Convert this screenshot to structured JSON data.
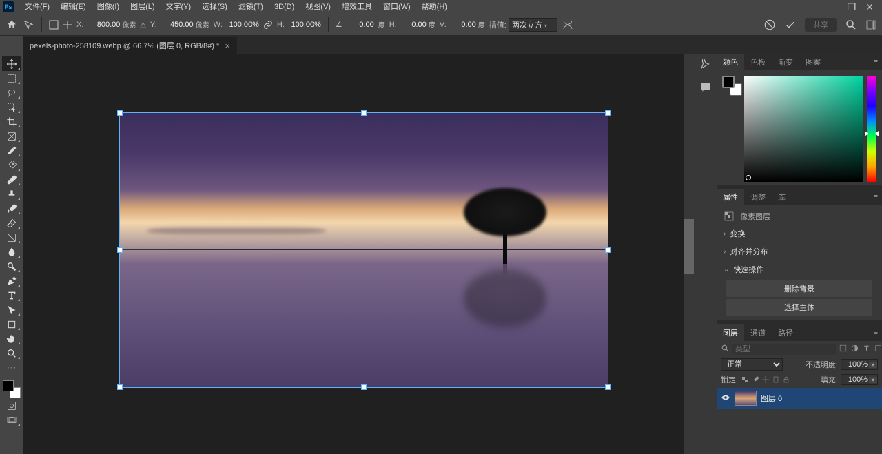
{
  "menu": {
    "file": "文件(F)",
    "edit": "编辑(E)",
    "image": "图像(I)",
    "layer": "图层(L)",
    "type": "文字(Y)",
    "select": "选择(S)",
    "filter": "滤镜(T)",
    "threed": "3D(D)",
    "view": "视图(V)",
    "plugins": "增效工具",
    "window": "窗口(W)",
    "help": "帮助(H)"
  },
  "optbar": {
    "x_lbl": "X:",
    "x": "800.00",
    "x_unit": "像素",
    "y_lbl": "Y:",
    "y": "450.00",
    "y_unit": "像素",
    "w_lbl": "W:",
    "w": "100.00%",
    "h_lbl": "H:",
    "h": "100.00%",
    "angle_icon": "△",
    "angle": "0.00",
    "angle_unit": "度",
    "hskew_lbl": "H:",
    "hskew": "0.00",
    "hskew_unit": "度",
    "vskew_lbl": "V:",
    "vskew": "0.00",
    "vskew_unit": "度",
    "interp_lbl": "插值:",
    "interp": "两次立方",
    "share": "共享"
  },
  "doc": {
    "title": "pexels-photo-258109.webp @ 66.7% (图层 0, RGB/8#) *"
  },
  "color_tabs": {
    "color": "颜色",
    "swatches": "色板",
    "gradients": "渐变",
    "patterns": "图案"
  },
  "props_tabs": {
    "properties": "属性",
    "adjust": "调整",
    "library": "库"
  },
  "props": {
    "pixel_layer": "像素图层",
    "transform": "变换",
    "align": "对齐并分布",
    "quick": "快速操作",
    "remove_bg": "删除背景",
    "select_subj": "选择主体"
  },
  "layers_tabs": {
    "layers": "图层",
    "channels": "通道",
    "paths": "路径"
  },
  "layers": {
    "filter_placeholder": "类型",
    "blend": "正常",
    "opacity_lbl": "不透明度:",
    "opacity": "100%",
    "lock_lbl": "锁定:",
    "fill_lbl": "填充:",
    "fill": "100%",
    "item": "图层 0"
  }
}
